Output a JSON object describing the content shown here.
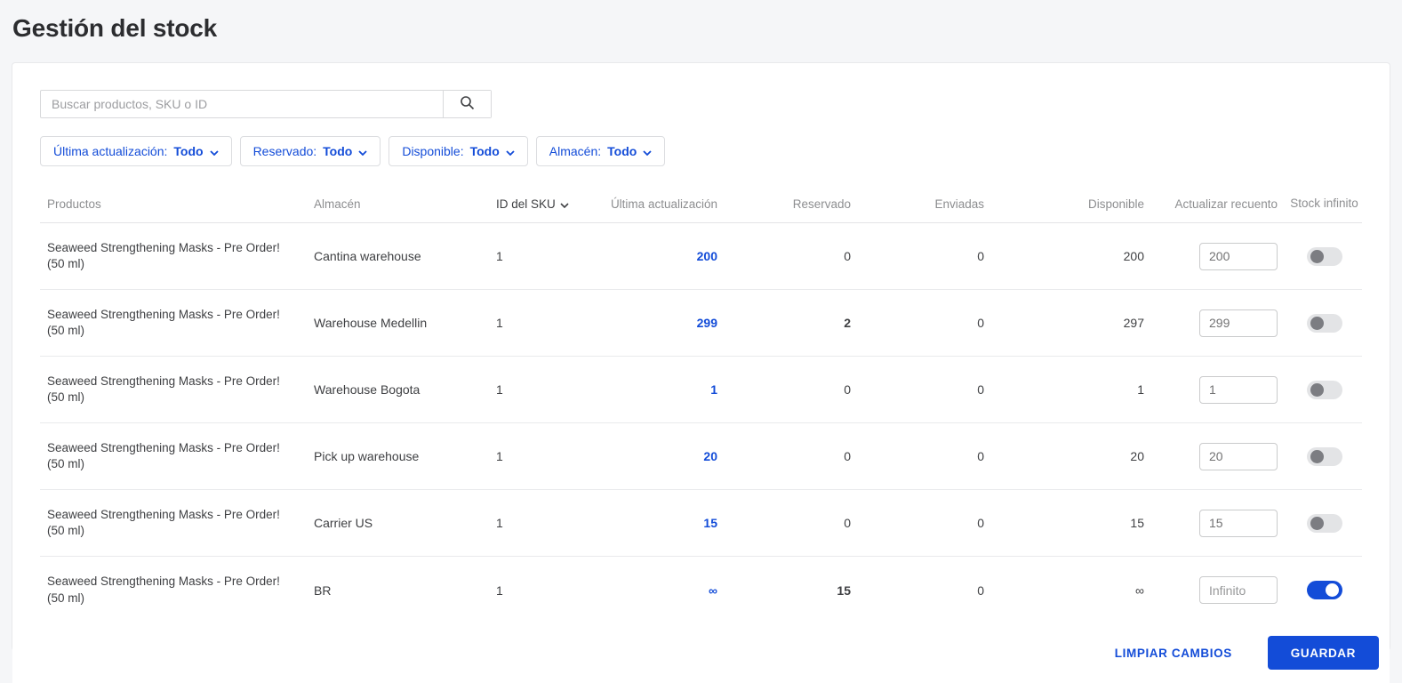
{
  "page": {
    "title": "Gestión del stock"
  },
  "search": {
    "placeholder": "Buscar productos, SKU o ID"
  },
  "filters": {
    "items": [
      {
        "label": "Última actualización:",
        "value": "Todo"
      },
      {
        "label": "Reservado:",
        "value": "Todo"
      },
      {
        "label": "Disponible:",
        "value": "Todo"
      },
      {
        "label": "Almacén:",
        "value": "Todo"
      }
    ]
  },
  "table": {
    "headers": {
      "products": "Productos",
      "warehouse": "Almacén",
      "sku": "ID del SKU",
      "last_update": "Última actualización",
      "reserved": "Reservado",
      "shipped": "Enviadas",
      "available": "Disponible",
      "update_count": "Actualizar recuento",
      "infinite_stock": "Stock infinito"
    },
    "rows": [
      {
        "product": "Seaweed Strengthening Masks - Pre Order! (50 ml)",
        "warehouse": "Cantina warehouse",
        "sku": "1",
        "last_update": "200",
        "reserved": "0",
        "reserved_highlight": false,
        "shipped": "0",
        "available": "200",
        "input": "200",
        "infinite": false
      },
      {
        "product": "Seaweed Strengthening Masks - Pre Order! (50 ml)",
        "warehouse": "Warehouse Medellin",
        "sku": "1",
        "last_update": "299",
        "reserved": "2",
        "reserved_highlight": true,
        "shipped": "0",
        "available": "297",
        "input": "299",
        "infinite": false
      },
      {
        "product": "Seaweed Strengthening Masks - Pre Order! (50 ml)",
        "warehouse": "Warehouse Bogota",
        "sku": "1",
        "last_update": "1",
        "reserved": "0",
        "reserved_highlight": false,
        "shipped": "0",
        "available": "1",
        "input": "1",
        "infinite": false
      },
      {
        "product": "Seaweed Strengthening Masks - Pre Order! (50 ml)",
        "warehouse": "Pick up warehouse",
        "sku": "1",
        "last_update": "20",
        "reserved": "0",
        "reserved_highlight": false,
        "shipped": "0",
        "available": "20",
        "input": "20",
        "infinite": false
      },
      {
        "product": "Seaweed Strengthening Masks - Pre Order! (50 ml)",
        "warehouse": "Carrier US",
        "sku": "1",
        "last_update": "15",
        "reserved": "0",
        "reserved_highlight": false,
        "shipped": "0",
        "available": "15",
        "input": "15",
        "infinite": false
      },
      {
        "product": "Seaweed Strengthening Masks - Pre Order! (50 ml)",
        "warehouse": "BR",
        "sku": "1",
        "last_update": "∞",
        "reserved": "15",
        "reserved_highlight": true,
        "shipped": "0",
        "available": "∞",
        "input": "Infinito",
        "infinite": true
      }
    ]
  },
  "footer": {
    "clear_label": "LIMPIAR CAMBIOS",
    "save_label": "GUARDAR"
  },
  "colors": {
    "accent": "#134cd8",
    "toggle_off_knob": "#7c7d82",
    "page_background": "#f5f6f8"
  }
}
